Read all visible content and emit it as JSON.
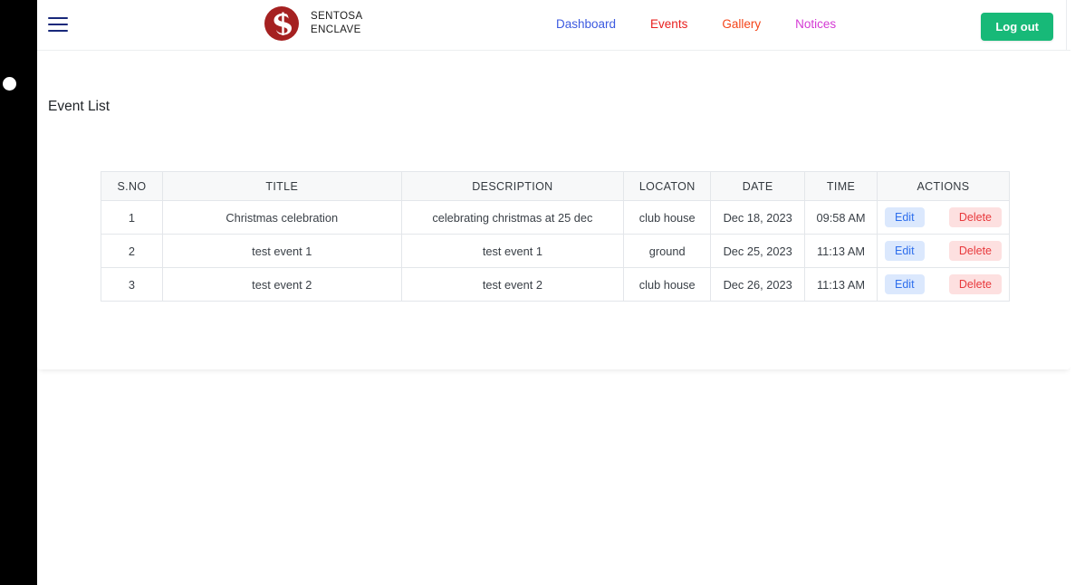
{
  "brand": {
    "line1": "SENTOSA",
    "line2": "ENCLAVE",
    "logo_color": "#a52121",
    "logo_icon": "sentosa-s-monogram"
  },
  "navbar": {
    "menu_icon": "hamburger-menu-icon",
    "links": [
      {
        "label": "Dashboard",
        "color": "#3c5ae0"
      },
      {
        "label": "Events",
        "color": "#e8201f"
      },
      {
        "label": "Gallery",
        "color": "#f4451a"
      },
      {
        "label": "Notices",
        "color": "#d43ad4"
      }
    ],
    "logout_label": "Log out",
    "logout_color": "#17b978"
  },
  "main": {
    "page_title": "Event List",
    "table": {
      "headers": [
        "S.NO",
        "TITLE",
        "DESCRIPTION",
        "LOCATON",
        "DATE",
        "TIME",
        "ACTIONS"
      ],
      "rows": [
        {
          "sno": "1",
          "title": "Christmas celebration",
          "description": "celebrating christmas at 25 dec",
          "location": "club house",
          "date": "Dec 18, 2023",
          "time": "09:58 AM",
          "edit_label": "Edit",
          "delete_label": "Delete"
        },
        {
          "sno": "2",
          "title": "test event 1",
          "description": "test event 1",
          "location": "ground",
          "date": "Dec 25, 2023",
          "time": "11:13 AM",
          "edit_label": "Edit",
          "delete_label": "Delete"
        },
        {
          "sno": "3",
          "title": "test event 2",
          "description": "test event 2",
          "location": "club house",
          "date": "Dec 26, 2023",
          "time": "11:13 AM",
          "edit_label": "Edit",
          "delete_label": "Delete"
        }
      ]
    }
  }
}
